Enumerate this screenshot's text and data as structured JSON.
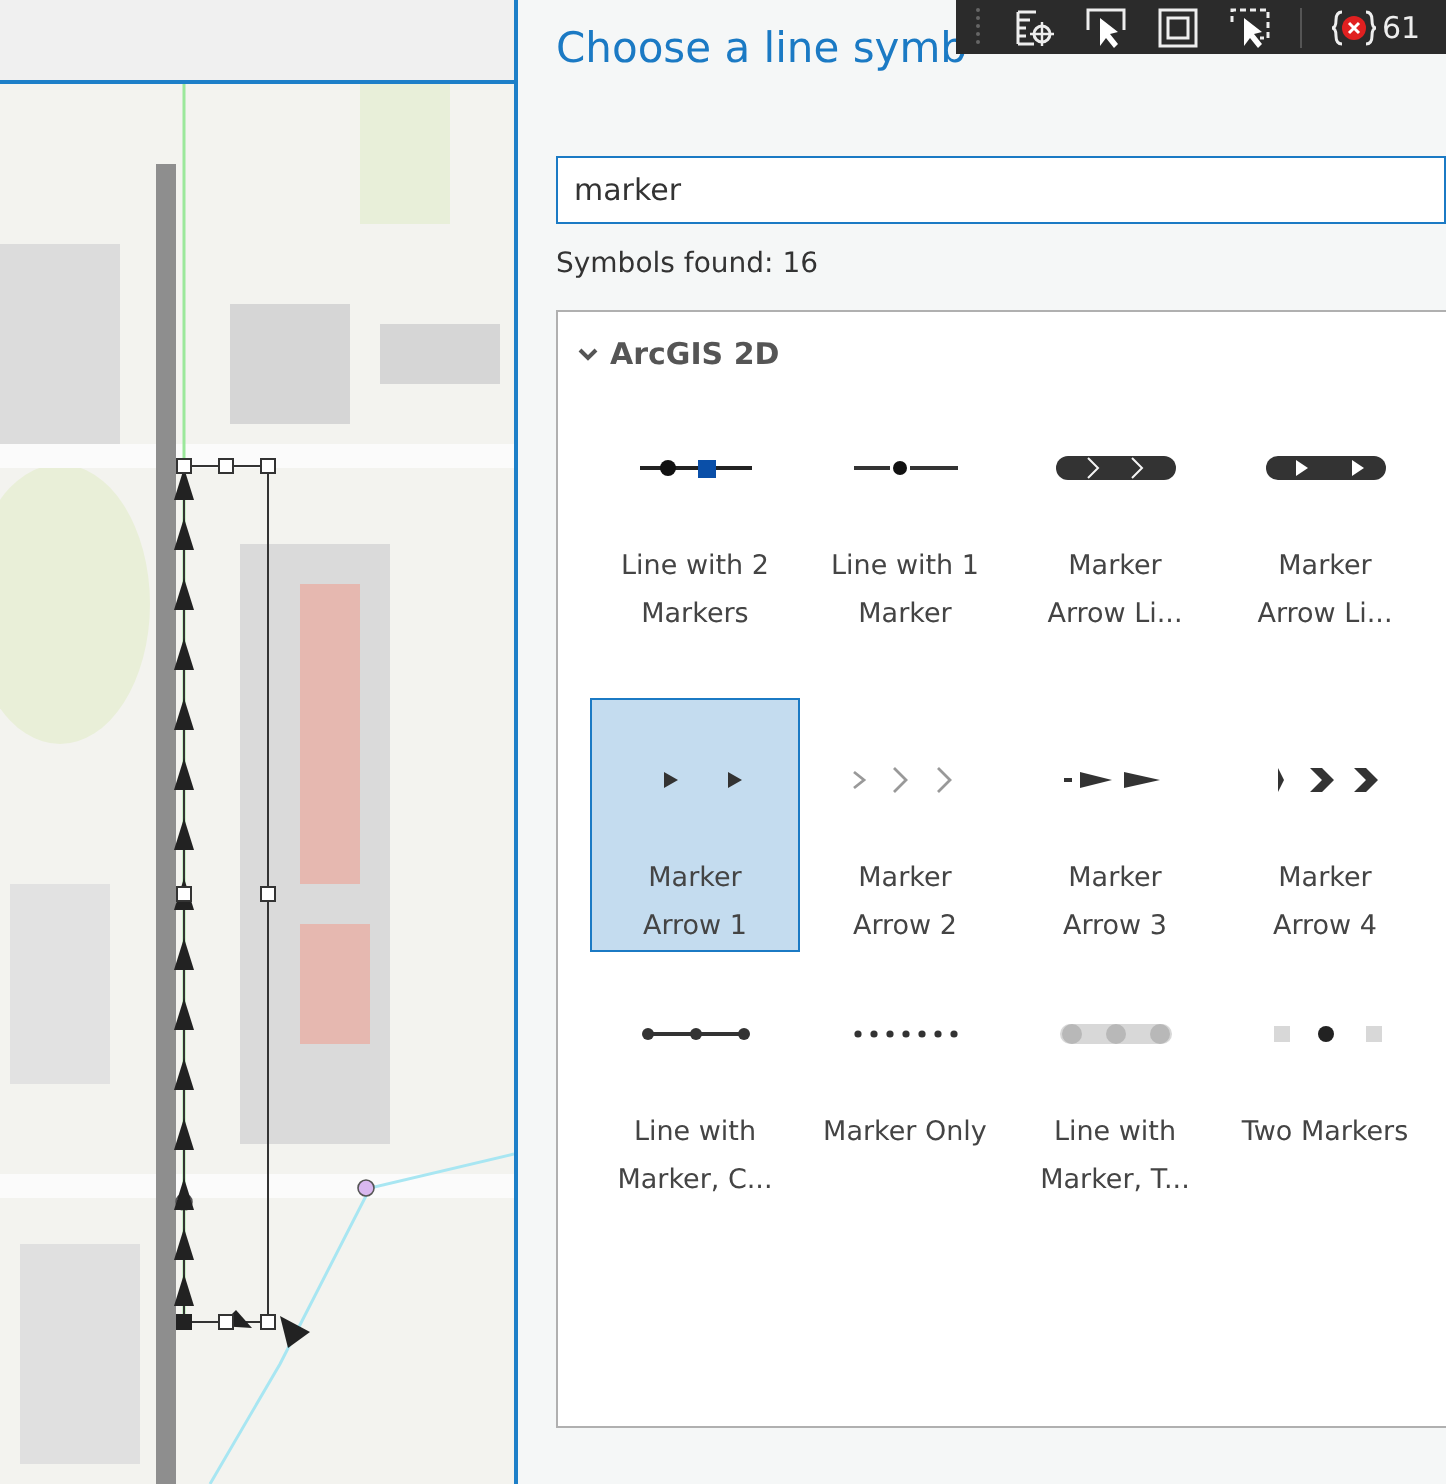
{
  "dialog": {
    "title": "Choose a line symb",
    "search": {
      "value": "marker"
    },
    "count": "Symbols found: 16",
    "gallery": {
      "group": {
        "label": "ArcGIS 2D",
        "expanded": true
      },
      "items": [
        {
          "label": "Line with 2 Markers",
          "kind": "line-two-markers",
          "selected": false
        },
        {
          "label": "Line with 1 Marker",
          "kind": "line-one-marker",
          "selected": false
        },
        {
          "label": "Marker Arrow Li...",
          "kind": "band-chevrons",
          "selected": false
        },
        {
          "label": "Marker Arrow Li...",
          "kind": "band-arrows",
          "selected": false
        },
        {
          "label": "Marker Arrow 1",
          "kind": "triangles",
          "selected": true
        },
        {
          "label": "Marker Arrow 2",
          "kind": "open-chevrons",
          "selected": false
        },
        {
          "label": "Marker Arrow 3",
          "kind": "long-arrows",
          "selected": false
        },
        {
          "label": "Marker Arrow 4",
          "kind": "bold-chevrons",
          "selected": false
        },
        {
          "label": "Line with Marker, C...",
          "kind": "line-dots",
          "selected": false
        },
        {
          "label": "Marker Only",
          "kind": "dots",
          "selected": false
        },
        {
          "label": "Line with Marker, T...",
          "kind": "grey-circles",
          "selected": false
        },
        {
          "label": "Two Markers",
          "kind": "two-markers",
          "selected": false
        }
      ]
    }
  },
  "toolbar": {
    "count": "61"
  }
}
